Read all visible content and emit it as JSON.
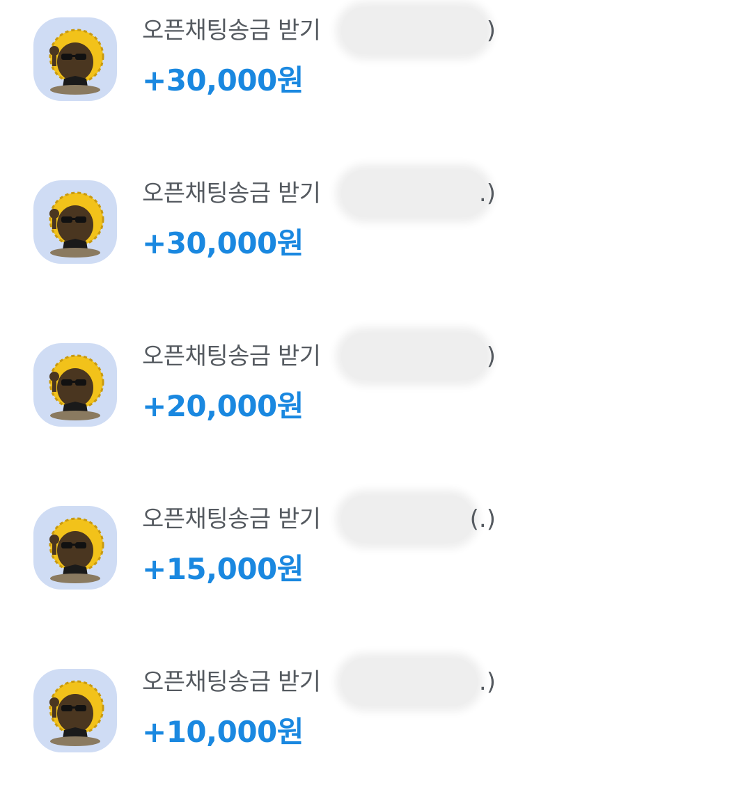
{
  "transactions": [
    {
      "title": "오픈채팅송금 받기",
      "name_suffix": ")",
      "amount": "+30,000원"
    },
    {
      "title": "오픈채팅송금 받기",
      "name_suffix": ".)",
      "amount": "+30,000원"
    },
    {
      "title": "오픈채팅송금 받기",
      "name_suffix": ")",
      "amount": "+20,000원"
    },
    {
      "title": "오픈채팅송금 받기",
      "name_suffix": "(.)",
      "amount": "+15,000원"
    },
    {
      "title": "오픈채팅송금 받기",
      "name_suffix": ".)",
      "amount": "+10,000원"
    }
  ],
  "icon": "character-avatar-icon",
  "colors": {
    "amount": "#1a88e0",
    "title": "#555a60",
    "avatar_bg": "#cfdcf4"
  }
}
